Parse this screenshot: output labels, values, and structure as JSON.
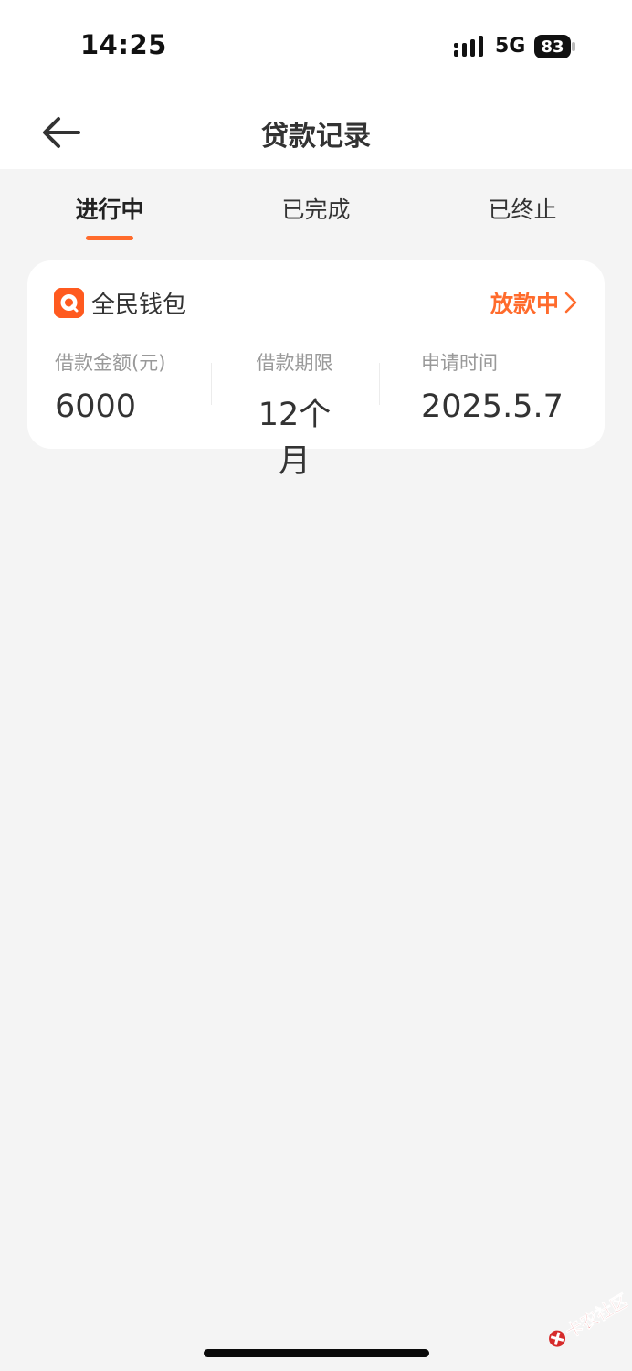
{
  "status_bar": {
    "time": "14:25",
    "network": "5G",
    "battery": "83"
  },
  "header": {
    "title": "贷款记录"
  },
  "tabs": [
    {
      "label": "进行中",
      "active": true
    },
    {
      "label": "已完成",
      "active": false
    },
    {
      "label": "已终止",
      "active": false
    }
  ],
  "loan_card": {
    "product_name": "全民钱包",
    "status": "放款中",
    "fields": [
      {
        "label": "借款金额(元)",
        "value": "6000"
      },
      {
        "label": "借款期限",
        "value": "12个月"
      },
      {
        "label": "申请时间",
        "value": "2025.5.7"
      }
    ]
  },
  "watermark": {
    "text": "卡农社区"
  },
  "colors": {
    "accent": "#ff6b2c",
    "brand_icon": "#ff5a1f",
    "background": "#f4f4f4"
  }
}
